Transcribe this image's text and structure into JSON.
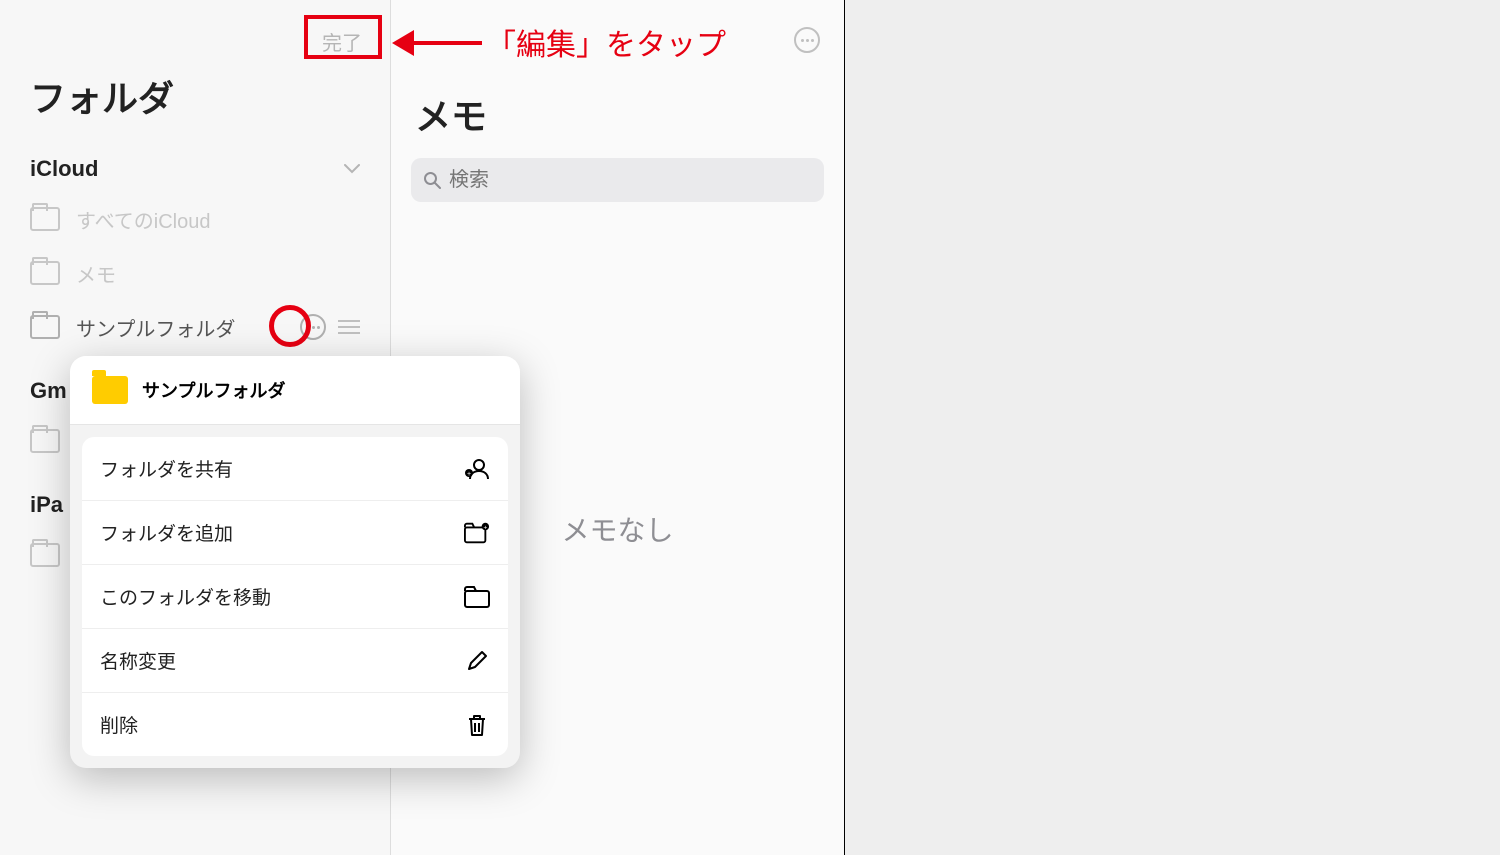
{
  "annotation": {
    "arrow_text": "「編集」をタップ"
  },
  "sidebar": {
    "done_label": "完了",
    "title": "フォルダ",
    "sections": {
      "icloud": {
        "label": "iCloud",
        "items": [
          {
            "label": "すべてのiCloud"
          },
          {
            "label": "メモ"
          },
          {
            "label": "サンプルフォルダ"
          }
        ]
      },
      "gmail": {
        "label": "Gm"
      },
      "ipad": {
        "label": "iPa"
      }
    }
  },
  "notes": {
    "title": "メモ",
    "search_placeholder": "検索",
    "empty_text": "メモなし"
  },
  "popup": {
    "title": "サンプルフォルダ",
    "menu": [
      {
        "label": "フォルダを共有"
      },
      {
        "label": "フォルダを追加"
      },
      {
        "label": "このフォルダを移動"
      },
      {
        "label": "名称変更"
      },
      {
        "label": "削除"
      }
    ]
  }
}
